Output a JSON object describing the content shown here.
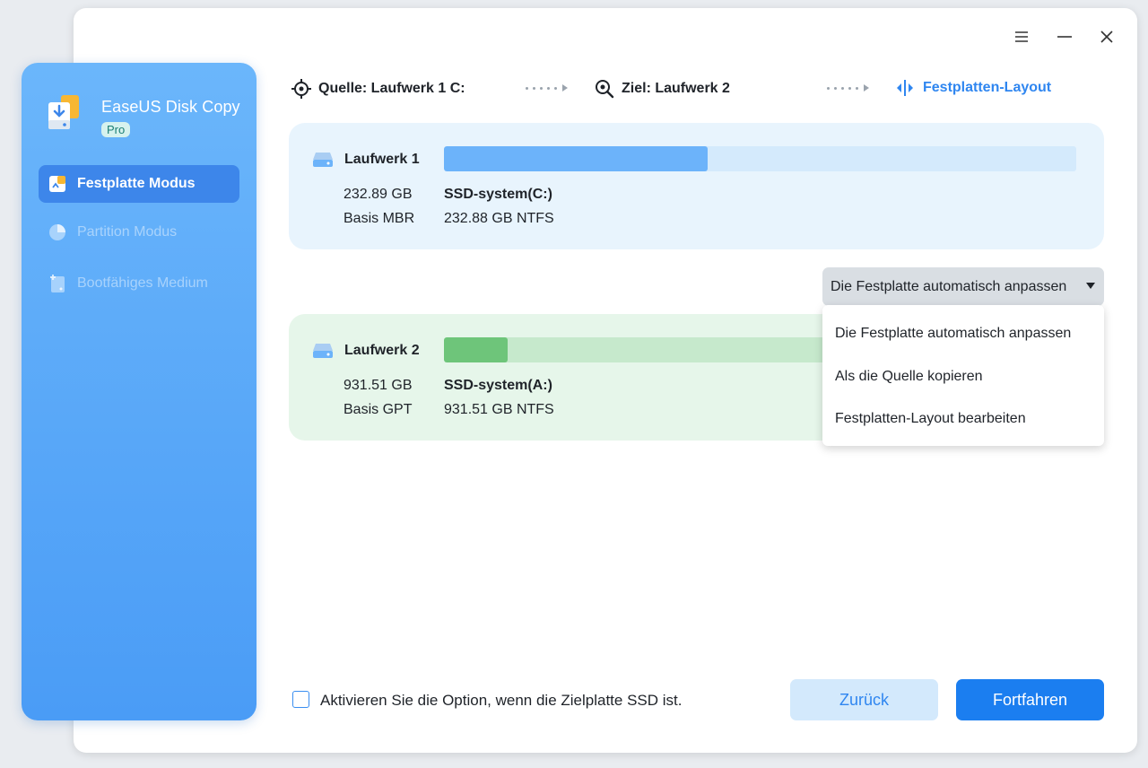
{
  "app": {
    "name": "EaseUS Disk Copy",
    "edition": "Pro"
  },
  "sidebar": {
    "items": [
      {
        "label": "Festplatte Modus",
        "icon": "disk-mode-icon",
        "state": "active"
      },
      {
        "label": "Partition Modus",
        "icon": "pie-chart-icon",
        "state": "disabled"
      },
      {
        "label": "Bootfähiges Medium",
        "icon": "bootable-media-icon",
        "state": "disabled"
      }
    ]
  },
  "window_controls": {
    "menu": "menu-icon",
    "minimize": "minimize-icon",
    "close": "close-icon"
  },
  "steps": {
    "source": "Quelle: Laufwerk 1 C:",
    "target": "Ziel: Laufwerk 2",
    "layout": "Festplatten-Layout"
  },
  "source_disk": {
    "name": "Laufwerk 1",
    "size": "232.89 GB",
    "type": "Basis MBR",
    "partition_name": "SSD-system(C:)",
    "partition_info": "232.88 GB NTFS",
    "usage_fraction": 0.417
  },
  "target_disk": {
    "name": "Laufwerk 2",
    "size": "931.51 GB",
    "type": "Basis GPT",
    "partition_name": "SSD-system(A:)",
    "partition_info": "931.51 GB NTFS",
    "usage_fraction": 0.1
  },
  "layout_dropdown": {
    "selected": "Die Festplatte automatisch anpassen",
    "options": [
      "Die Festplatte automatisch anpassen",
      "Als die Quelle kopieren",
      "Festplatten-Layout bearbeiten"
    ]
  },
  "ssd_option": {
    "label": "Aktivieren Sie die Option, wenn die Zielplatte SSD ist.",
    "checked": false
  },
  "buttons": {
    "back": "Zurück",
    "next": "Fortfahren"
  },
  "colors": {
    "accent": "#1b7ef0",
    "source_bar": "#6cb3fa",
    "target_bar": "#6ec57a"
  }
}
